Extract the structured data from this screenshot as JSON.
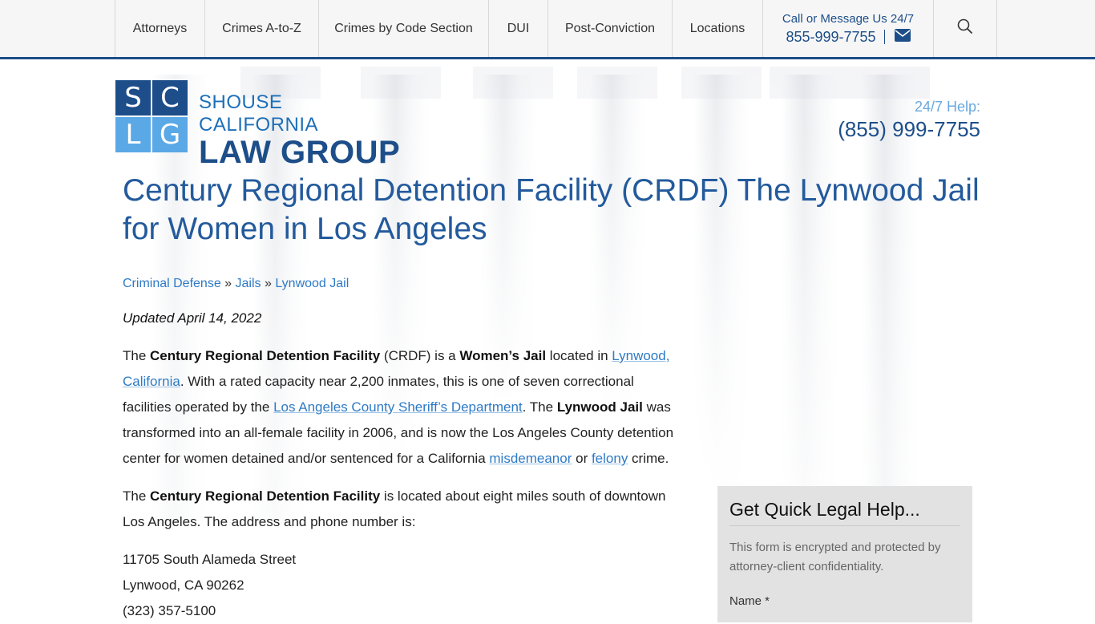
{
  "nav": {
    "items": [
      {
        "label": "Attorneys",
        "w": 111
      },
      {
        "label": "Crimes A-to-Z",
        "w": 141
      },
      {
        "label": "Crimes by Code Section",
        "w": 211
      },
      {
        "label": "DUI",
        "w": 73
      },
      {
        "label": "Post-Conviction",
        "w": 154
      },
      {
        "label": "Locations",
        "w": 112
      }
    ],
    "contact_label": "Call or Message Us 24/7",
    "contact_phone": "855-999-7755"
  },
  "logo": {
    "letters": [
      "S",
      "C",
      "L",
      "G"
    ],
    "top_text": "SHOUSE CALIFORNIA",
    "bottom_text": "LAW GROUP"
  },
  "help": {
    "label": "24/7 Help:",
    "phone": "(855) 999-7755"
  },
  "page": {
    "title": "Century Regional Detention Facility (CRDF) The Lynwood Jail for Women in Los Angeles",
    "breadcrumb": [
      "Criminal Defense",
      "Jails",
      "Lynwood Jail"
    ],
    "breadcrumb_sep": "»",
    "updated": "Updated April 14, 2022",
    "p1": {
      "t1": "The ",
      "b1": "Century Regional Detention Facility",
      "t2": " (CRDF) is a ",
      "b2": "Women’s Jail",
      "t3": " located in ",
      "l1": "Lynwood, California",
      "t4": ". With a rated capacity near 2,200 inmates, this is one of seven correctional facilities operated by the ",
      "l2": "Los Angeles County Sheriff’s Department",
      "t5": ". The ",
      "b3": "Lynwood Jail",
      "t6": " was transformed into an all-female facility in 2006, and is now the Los Angeles County detention center for women detained and/or sentenced for a California ",
      "l3": "misdemeanor",
      "t7": " or ",
      "l4": "felony",
      "t8": " crime."
    },
    "p2": {
      "t1": "The ",
      "b1": "Century Regional Detention Facility",
      "t2": " is located about eight miles south of downtown Los Angeles. The address and phone number is:"
    },
    "address": [
      "11705 South Alameda Street",
      "Lynwood, CA 90262",
      "(323) 357-5100"
    ]
  },
  "form": {
    "title": "Get Quick Legal Help...",
    "desc": "This form is encrypted and protected by attorney-client confidentiality.",
    "name_label": "Name *"
  },
  "colors": {
    "brand_dark": "#1d4e89",
    "brand_light": "#5ba8e6",
    "link": "#2e7ac5"
  }
}
